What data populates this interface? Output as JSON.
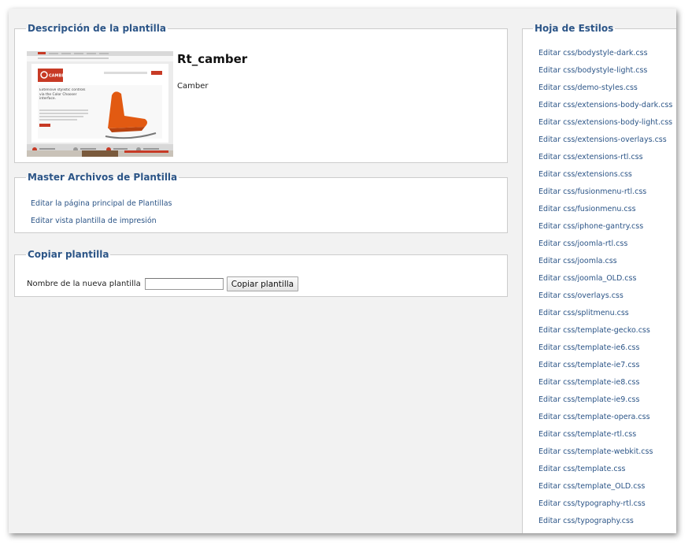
{
  "descripcion": {
    "legend": "Descripción de la plantilla",
    "template_name": "Rt_camber",
    "template_description": "Camber",
    "thumbnail": {
      "logo": "CAMBER",
      "headline": "Extensive stylistic controls via the Color Chooser interface."
    }
  },
  "master": {
    "legend": "Master Archivos de Plantilla",
    "links": [
      "Editar la página principal de Plantillas",
      "Editar vista plantilla de impresión"
    ]
  },
  "copiar": {
    "legend": "Copiar plantilla",
    "field_label": "Nombre de la nueva plantilla",
    "field_value": "",
    "button_label": "Copiar plantilla"
  },
  "hoja_estilos": {
    "legend": "Hoja de Estilos",
    "links": [
      "Editar css/bodystyle-dark.css",
      "Editar css/bodystyle-light.css",
      "Editar css/demo-styles.css",
      "Editar css/extensions-body-dark.css",
      "Editar css/extensions-body-light.css",
      "Editar css/extensions-overlays.css",
      "Editar css/extensions-rtl.css",
      "Editar css/extensions.css",
      "Editar css/fusionmenu-rtl.css",
      "Editar css/fusionmenu.css",
      "Editar css/iphone-gantry.css",
      "Editar css/joomla-rtl.css",
      "Editar css/joomla.css",
      "Editar css/joomla_OLD.css",
      "Editar css/overlays.css",
      "Editar css/splitmenu.css",
      "Editar css/template-gecko.css",
      "Editar css/template-ie6.css",
      "Editar css/template-ie7.css",
      "Editar css/template-ie8.css",
      "Editar css/template-ie9.css",
      "Editar css/template-opera.css",
      "Editar css/template-rtl.css",
      "Editar css/template-webkit.css",
      "Editar css/template.css",
      "Editar css/template_OLD.css",
      "Editar css/typography-rtl.css",
      "Editar css/typography.css"
    ]
  },
  "colors": {
    "legend": "#2c5587",
    "link": "#2c5587",
    "panel_bg": "#f2f2f2",
    "accent_red": "#c73a25",
    "chair_orange": "#e25a12"
  }
}
